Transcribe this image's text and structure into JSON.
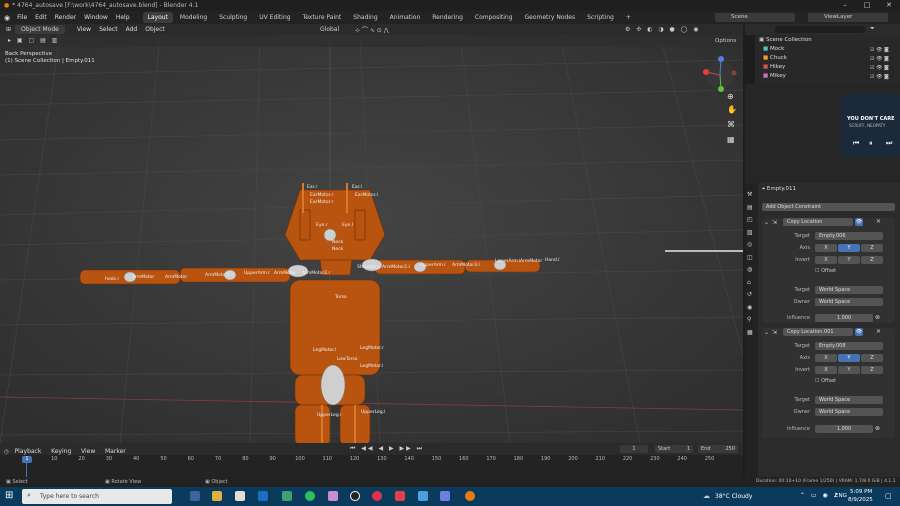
{
  "window": {
    "title": "* 4764_autosave [F:\\work\\4764_autosave.blend] - Blender 4.1"
  },
  "menu": [
    "File",
    "Edit",
    "Render",
    "Window",
    "Help"
  ],
  "workspaces": [
    {
      "label": "Layout",
      "active": true
    },
    {
      "label": "Modeling"
    },
    {
      "label": "Sculpting"
    },
    {
      "label": "UV Editing"
    },
    {
      "label": "Texture Paint"
    },
    {
      "label": "Shading"
    },
    {
      "label": "Animation"
    },
    {
      "label": "Rendering"
    },
    {
      "label": "Compositing"
    },
    {
      "label": "Geometry Nodes"
    },
    {
      "label": "Scripting"
    }
  ],
  "scene": {
    "name": "Scene",
    "view_layer": "ViewLayer"
  },
  "viewport_header": {
    "mode": "Object Mode",
    "menus": [
      "View",
      "Select",
      "Add",
      "Object"
    ],
    "orientation": "Global",
    "options": "Options"
  },
  "viewport_info": {
    "line1": "Back Perspective",
    "line2": "(1) Scene Collection | Empty.011"
  },
  "bone_labels": [
    "Ear.r",
    "Ear.l",
    "EarMotor.l",
    "EarMotor.r",
    "EarMotor.r",
    "Eye.r",
    "Eye.l",
    "Neck",
    "Neck",
    "hook.r",
    "ArmMotor",
    "ArmMotor",
    "ArmMotor1.r",
    "UpperArm.r",
    "ArmMotor",
    "ArmMotor2.r",
    "Shoulder.l",
    "ArmMotor2.l",
    "UpperArm.l",
    "ArmMotor3.l",
    "LowerArm.l",
    "ArmMotor",
    "Hand.l",
    "Torso",
    "LegMotor.l",
    "LegMotor.r",
    "LowTorso",
    "LegMotor.l",
    "UpperLeg.r",
    "UpperLeg.l"
  ],
  "outliner": {
    "root": "Scene Collection",
    "items": [
      {
        "name": "Mock",
        "color": "#4fc1c1"
      },
      {
        "name": "Chuck",
        "color": "#f0a030"
      },
      {
        "name": "Hikey",
        "color": "#e05050"
      },
      {
        "name": "Mikey",
        "color": "#d070c0"
      }
    ]
  },
  "media_overlay": {
    "line1": "YOU DON'T CARE",
    "line2": "SCRUFF, NEOPATY"
  },
  "properties": {
    "object": "Empty.011",
    "add_constraint": "Add Object Constraint",
    "constraints": [
      {
        "name": "Copy Location",
        "target": "Empty.006",
        "axis": [
          "X",
          "Y",
          "Z"
        ],
        "invert": [
          "X",
          "Y",
          "Z"
        ],
        "offset": "Offset",
        "target_space": "World Space",
        "owner_space": "World Space",
        "influence": "1.000"
      },
      {
        "name": "Copy Location.001",
        "target": "Empty.008",
        "axis": [
          "X",
          "Y",
          "Z"
        ],
        "invert": [
          "X",
          "Y",
          "Z"
        ],
        "offset": "Offset",
        "target_space": "World Space",
        "owner_space": "World Space",
        "influence": "1.000"
      }
    ],
    "labels": {
      "target": "Target",
      "axis": "Axis",
      "invert": "Invert",
      "owner": "Owner",
      "influence": "Influence"
    }
  },
  "timeline": {
    "menus": [
      "Playback",
      "Keying",
      "View",
      "Marker"
    ],
    "current": "1",
    "start_label": "Start",
    "start": "1",
    "end_label": "End",
    "end": "250",
    "ticks": [
      "0",
      "10",
      "20",
      "30",
      "40",
      "50",
      "60",
      "70",
      "80",
      "90",
      "100",
      "110",
      "120",
      "130",
      "140",
      "150",
      "160",
      "170",
      "180",
      "190",
      "200",
      "210",
      "220",
      "230",
      "240",
      "250"
    ]
  },
  "status": {
    "select": "Select",
    "rotate": "Rotate View",
    "object": "Object",
    "info": "Duration: 00:10+10 (Frame 1/250) | VRAM: 1.7/8.0 GiB | 4.1.1"
  },
  "taskbar": {
    "search": "Type here to search",
    "weather": "38°C  Cloudy",
    "lang": "ENG",
    "time": "5:09 PM",
    "date": "8/9/2025"
  }
}
